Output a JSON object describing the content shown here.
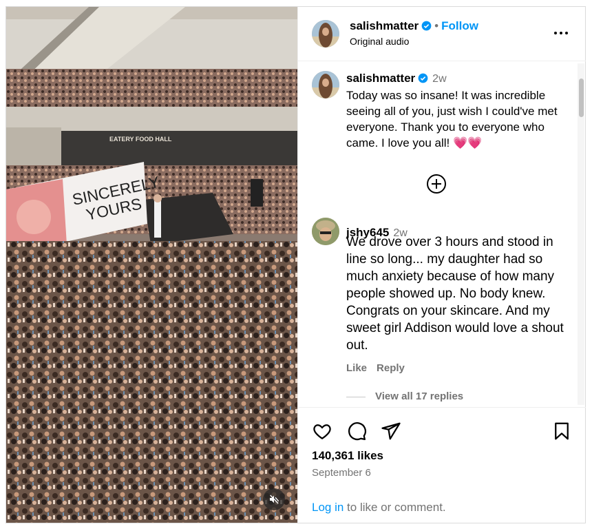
{
  "post": {
    "username": "salishmatter",
    "follow_label": "Follow",
    "separator": "•",
    "audio": "Original audio"
  },
  "caption": {
    "username": "salishmatter",
    "time": "2w",
    "text": "Today was so insane! It was incredible seeing all of you, just wish I could've met everyone. Thank you to everyone who came. I love you all! 💗💗"
  },
  "comment": {
    "username": "jshy645",
    "time": "2w",
    "text": "We drove over 3 hours and stood in line so long... my daughter had so much anxiety because of how many people showed up. No body knew. Congrats on your skincare. And my sweet girl Addison would love a shout out.",
    "like_label": "Like",
    "reply_label": "Reply",
    "view_replies": "View all 17 replies"
  },
  "media": {
    "banner_text_line1": "SINCERELY",
    "banner_text_line2": "YOURS",
    "sign_text": "EATERY FOOD HALL"
  },
  "engagement": {
    "likes": "140,361 likes",
    "date": "September 6"
  },
  "footer": {
    "login_link": "Log in",
    "login_rest": " to like or comment."
  },
  "colors": {
    "accent": "#0095f6",
    "muted": "#737373",
    "border": "#dbdbdb"
  },
  "icons": [
    "verified-badge-icon",
    "more-options-icon",
    "add-circle-icon",
    "heart-icon",
    "comment-icon",
    "share-icon",
    "bookmark-icon",
    "muted-speaker-icon"
  ]
}
